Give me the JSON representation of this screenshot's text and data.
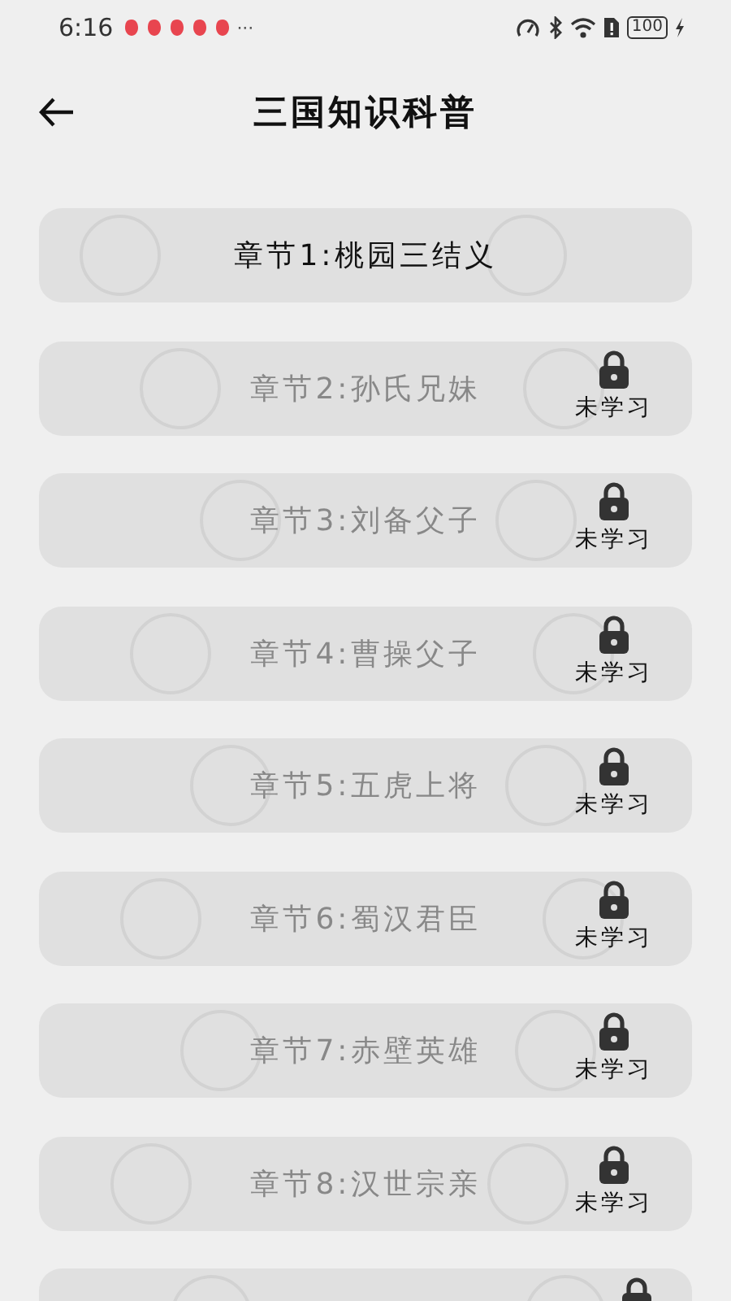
{
  "status_bar": {
    "time": "6:16",
    "notifications": [
      {
        "color": "#e8454f"
      },
      {
        "color": "#e8454f"
      },
      {
        "color": "#e8454f"
      },
      {
        "color": "#e8454f"
      },
      {
        "color": "#e8454f"
      }
    ],
    "more": "···",
    "battery": "100"
  },
  "header": {
    "title": "三国知识科普"
  },
  "chapters": [
    {
      "title": "章节1:桃园三结义",
      "locked": false
    },
    {
      "title": "章节2:孙氏兄妹",
      "locked": true,
      "status": "未学习"
    },
    {
      "title": "章节3:刘备父子",
      "locked": true,
      "status": "未学习"
    },
    {
      "title": "章节4:曹操父子",
      "locked": true,
      "status": "未学习"
    },
    {
      "title": "章节5:五虎上将",
      "locked": true,
      "status": "未学习"
    },
    {
      "title": "章节6:蜀汉君臣",
      "locked": true,
      "status": "未学习"
    },
    {
      "title": "章节7:赤壁英雄",
      "locked": true,
      "status": "未学习"
    },
    {
      "title": "章节8:汉世宗亲",
      "locked": true,
      "status": "未学习"
    },
    {
      "locked": true
    }
  ]
}
